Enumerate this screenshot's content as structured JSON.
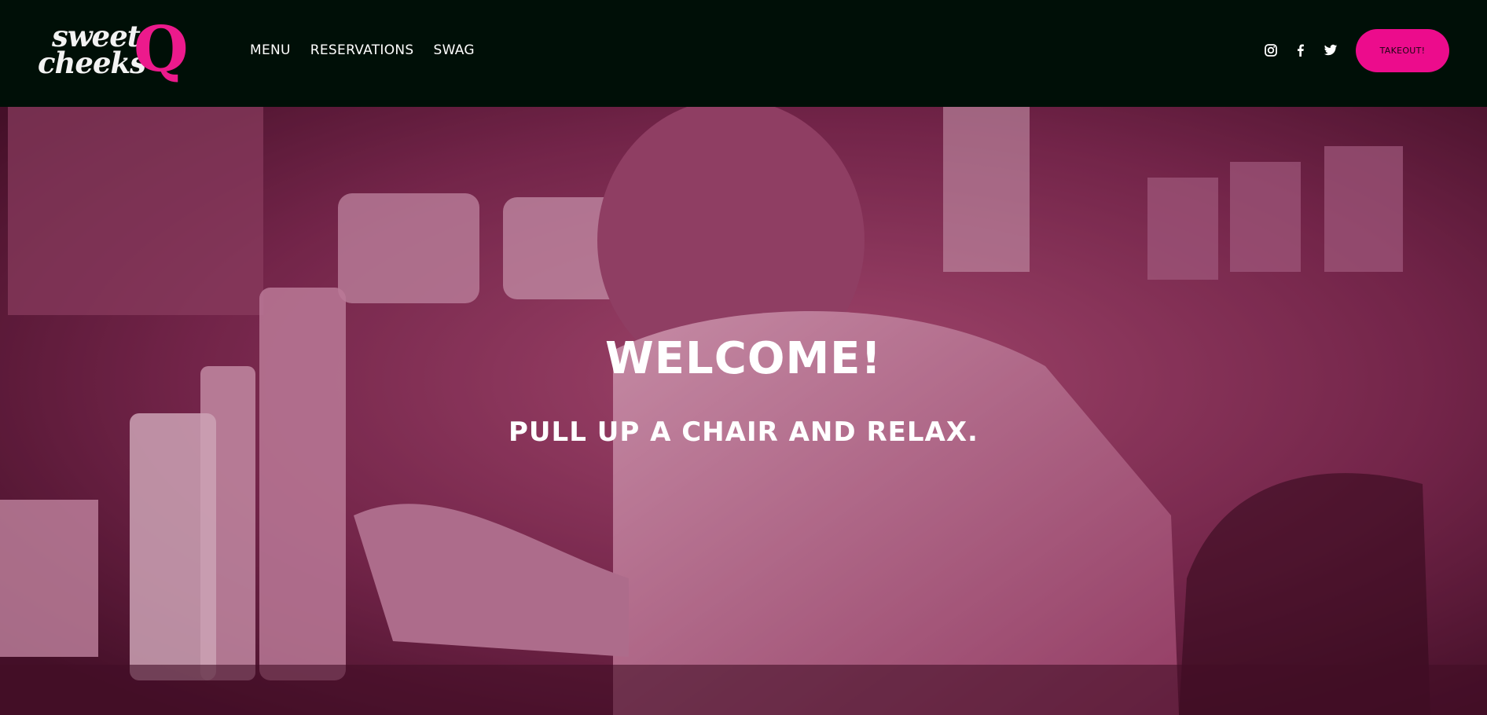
{
  "brand": {
    "logo_line1": "sweet",
    "logo_line2": "cheeks",
    "logo_mark": "Q",
    "accent_color": "#ec0c8c",
    "header_bg": "#000f07"
  },
  "nav": {
    "items": [
      {
        "label": "MENU"
      },
      {
        "label": "RESERVATIONS"
      },
      {
        "label": "SWAG"
      }
    ]
  },
  "social": {
    "icons": [
      "instagram-icon",
      "facebook-icon",
      "twitter-icon"
    ]
  },
  "header": {
    "cta_label": "TAKEOUT!"
  },
  "hero": {
    "title": "WELCOME!",
    "subtitle": "PULL UP A CHAIR AND RELAX."
  }
}
